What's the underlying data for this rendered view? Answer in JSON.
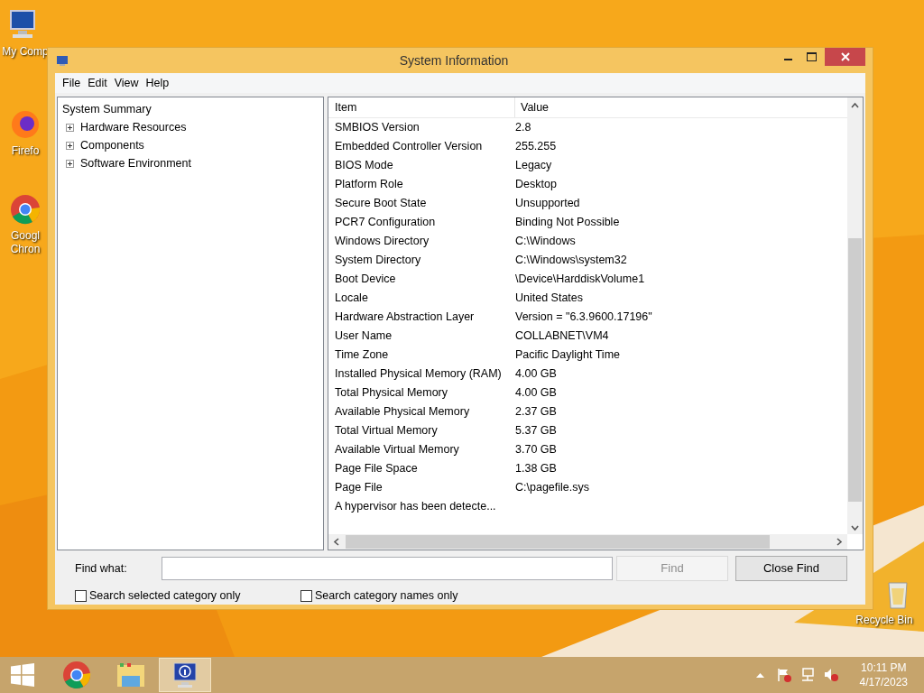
{
  "desktop_icons": [
    {
      "kind": "computer",
      "lines": [
        "My Comp"
      ]
    },
    {
      "kind": "firefox",
      "lines": [
        "Firefo"
      ]
    },
    {
      "kind": "chrome",
      "lines": [
        "Googl",
        "Chron"
      ]
    },
    {
      "kind": "recycle",
      "lines": [
        "Recycle Bin"
      ]
    }
  ],
  "window": {
    "title": "System Information",
    "menu": [
      "File",
      "Edit",
      "View",
      "Help"
    ],
    "tree": {
      "label": "System Summary",
      "children": [
        {
          "label": "Hardware Resources",
          "expanded": false
        },
        {
          "label": "Components",
          "expanded": false
        },
        {
          "label": "Software Environment",
          "expanded": false
        }
      ]
    },
    "table": {
      "columns": [
        "Item",
        "Value"
      ],
      "rows": [
        [
          "SMBIOS Version",
          "2.8"
        ],
        [
          "Embedded Controller Version",
          "255.255"
        ],
        [
          "BIOS Mode",
          "Legacy"
        ],
        [
          "Platform Role",
          "Desktop"
        ],
        [
          "Secure Boot State",
          "Unsupported"
        ],
        [
          "PCR7 Configuration",
          "Binding Not Possible"
        ],
        [
          "Windows Directory",
          "C:\\Windows"
        ],
        [
          "System Directory",
          "C:\\Windows\\system32"
        ],
        [
          "Boot Device",
          "\\Device\\HarddiskVolume1"
        ],
        [
          "Locale",
          "United States"
        ],
        [
          "Hardware Abstraction Layer",
          "Version = \"6.3.9600.17196\""
        ],
        [
          "User Name",
          "COLLABNET\\VM4"
        ],
        [
          "Time Zone",
          "Pacific Daylight Time"
        ],
        [
          "Installed Physical Memory (RAM)",
          "4.00 GB"
        ],
        [
          "Total Physical Memory",
          "4.00 GB"
        ],
        [
          "Available Physical Memory",
          "2.37 GB"
        ],
        [
          "Total Virtual Memory",
          "5.37 GB"
        ],
        [
          "Available Virtual Memory",
          "3.70 GB"
        ],
        [
          "Page File Space",
          "1.38 GB"
        ],
        [
          "Page File",
          "C:\\pagefile.sys"
        ],
        [
          "A hypervisor has been detecte...",
          ""
        ]
      ]
    },
    "find": {
      "label": "Find what:",
      "buttons": [
        {
          "label": "Find",
          "disabled": true
        },
        {
          "label": "Close Find",
          "disabled": false
        }
      ],
      "checkboxes": [
        {
          "label": "Search selected category only",
          "checked": false
        },
        {
          "label": "Search category names only",
          "checked": false
        }
      ]
    }
  },
  "taskbar": {
    "apps": [
      {
        "kind": "start",
        "active": false
      },
      {
        "kind": "chrome",
        "active": false
      },
      {
        "kind": "folder",
        "active": false
      },
      {
        "kind": "sysinfo",
        "active": true
      }
    ],
    "time": "10:11 PM",
    "date": "4/17/2023"
  }
}
